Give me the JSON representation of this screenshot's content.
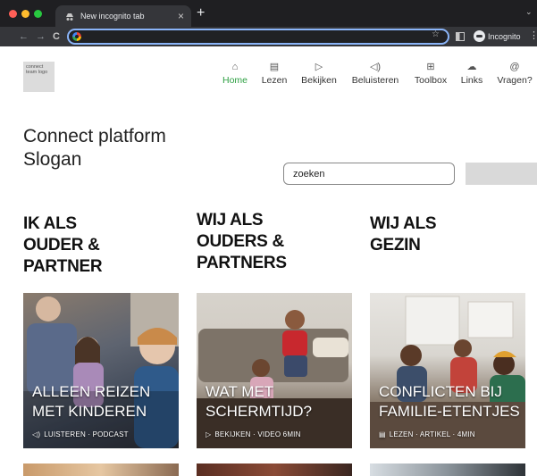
{
  "browser": {
    "tab_title": "New incognito tab",
    "close_glyph": "×",
    "new_tab_glyph": "+",
    "tab_menu_glyph": "⌄",
    "back_glyph": "←",
    "forward_glyph": "→",
    "reload_glyph": "C",
    "star_glyph": "☆",
    "incognito_label": "Incognito",
    "more_glyph": "⋮",
    "address_value": ""
  },
  "site": {
    "logo_text": "connect team logo",
    "nav": [
      {
        "label": "Home",
        "icon": "home-icon",
        "glyph": "⌂",
        "active": true
      },
      {
        "label": "Lezen",
        "icon": "document-icon",
        "glyph": "▤",
        "active": false
      },
      {
        "label": "Bekijken",
        "icon": "play-icon",
        "glyph": "▷",
        "active": false
      },
      {
        "label": "Beluisteren",
        "icon": "speaker-icon",
        "glyph": "◁)",
        "active": false
      },
      {
        "label": "Toolbox",
        "icon": "gift-icon",
        "glyph": "⊞",
        "active": false
      },
      {
        "label": "Links",
        "icon": "cloud-icon",
        "glyph": "☁",
        "active": false
      },
      {
        "label": "Vragen?",
        "icon": "at-icon",
        "glyph": "@",
        "active": false
      }
    ],
    "title_line1": "Connect platform",
    "title_line2": "Slogan",
    "search_value": "zoeken",
    "columns": [
      {
        "heading": [
          "IK ALS",
          "OUDER &",
          "PARTNER"
        ]
      },
      {
        "heading": [
          "WIJ ALS",
          "OUDERS &",
          "PARTNERS"
        ]
      },
      {
        "heading": [
          "WIJ ALS",
          "GEZIN"
        ]
      }
    ],
    "cards": [
      {
        "title": [
          "ALLEEN REIZEN",
          "MET KINDEREN"
        ],
        "meta_icon": "speaker-icon",
        "meta_glyph": "◁)",
        "meta": "LUISTEREN · PODCAST"
      },
      {
        "title": [
          "WAT MET",
          "SCHERMTIJD?"
        ],
        "meta_icon": "play-icon",
        "meta_glyph": "▷",
        "meta": "BEKIJKEN · VIDEO 6MIN"
      },
      {
        "title": [
          "CONFLICTEN BIJ",
          "FAMILIE-ETENTJES"
        ],
        "meta_icon": "document-icon",
        "meta_glyph": "▤",
        "meta": "LEZEN · ARTIKEL · 4MIN"
      }
    ]
  },
  "colors": {
    "active_nav": "#2ea043",
    "chrome_dark": "#1f1f22",
    "omnibox_focus": "#8ab4f8"
  }
}
